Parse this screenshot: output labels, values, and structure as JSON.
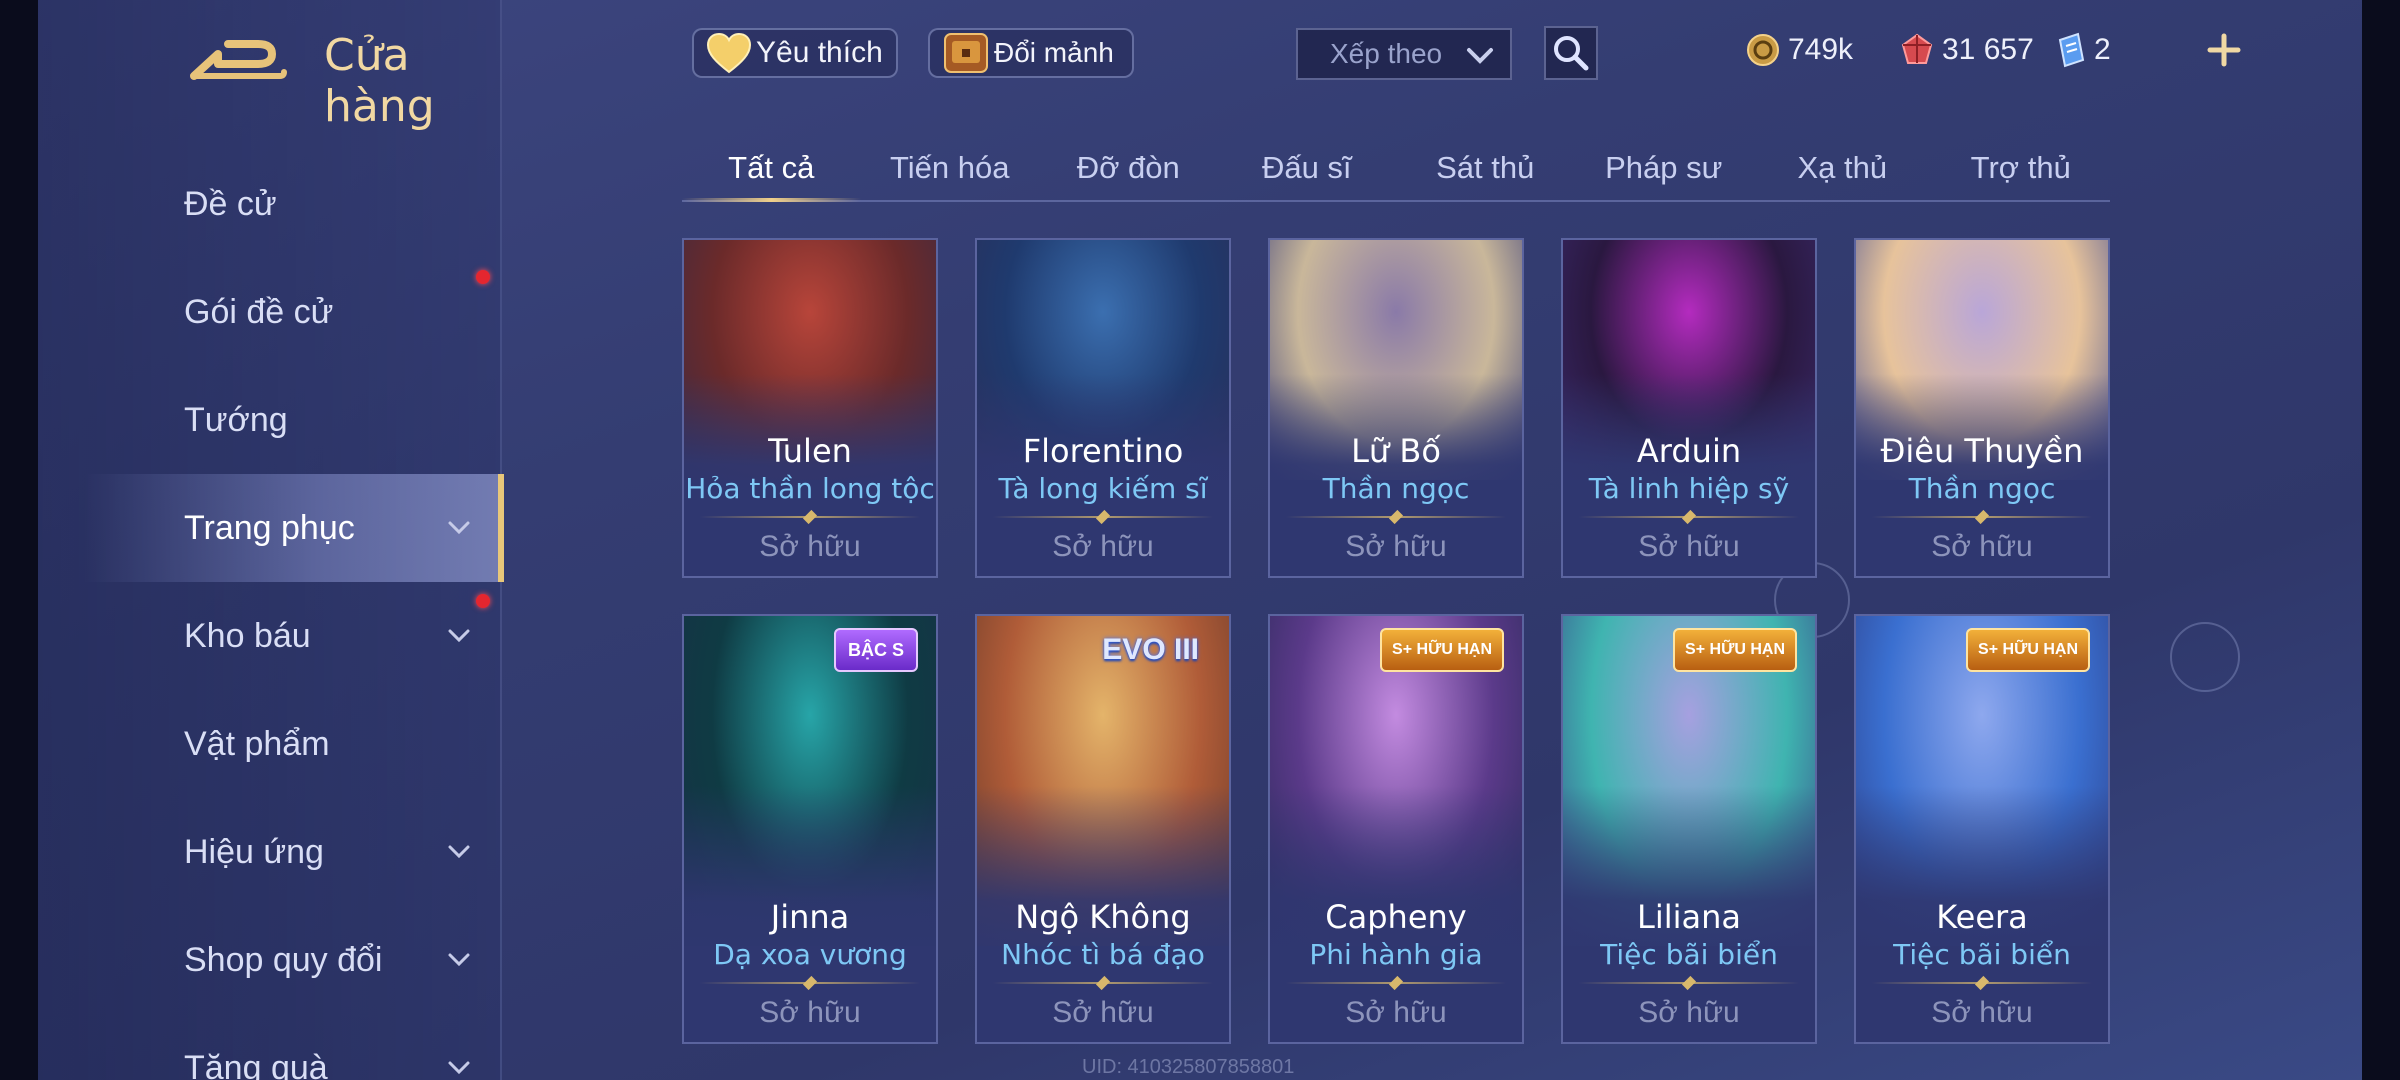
{
  "header": {
    "title": "Cửa hàng",
    "favorite_label": "Yêu thích",
    "fragment_label": "Đổi mảnh",
    "sort_placeholder": "Xếp theo"
  },
  "currencies": [
    {
      "icon": "gold-coin-icon",
      "value": "749k"
    },
    {
      "icon": "red-gem-icon",
      "value": "31 657"
    },
    {
      "icon": "blue-voucher-icon",
      "value": "2"
    }
  ],
  "sidebar": {
    "items": [
      {
        "label": "Đề cử",
        "has_chevron": false,
        "has_dot": false,
        "active": false
      },
      {
        "label": "Gói đề cử",
        "has_chevron": false,
        "has_dot": true,
        "active": false
      },
      {
        "label": "Tướng",
        "has_chevron": false,
        "has_dot": false,
        "active": false
      },
      {
        "label": "Trang phục",
        "has_chevron": true,
        "has_dot": false,
        "active": true
      },
      {
        "label": "Kho báu",
        "has_chevron": true,
        "has_dot": true,
        "active": false
      },
      {
        "label": "Vật phẩm",
        "has_chevron": false,
        "has_dot": false,
        "active": false
      },
      {
        "label": "Hiệu ứng",
        "has_chevron": true,
        "has_dot": false,
        "active": false
      },
      {
        "label": "Shop quy đổi",
        "has_chevron": true,
        "has_dot": false,
        "active": false
      },
      {
        "label": "Tặng quà",
        "has_chevron": true,
        "has_dot": false,
        "active": false
      }
    ]
  },
  "tabs": [
    {
      "label": "Tất cả",
      "active": true
    },
    {
      "label": "Tiến hóa",
      "active": false
    },
    {
      "label": "Đỡ đòn",
      "active": false
    },
    {
      "label": "Đấu sĩ",
      "active": false
    },
    {
      "label": "Sát thủ",
      "active": false
    },
    {
      "label": "Pháp sư",
      "active": false
    },
    {
      "label": "Xạ thủ",
      "active": false
    },
    {
      "label": "Trợ thủ",
      "active": false
    }
  ],
  "cards": [
    {
      "hero": "Tulen",
      "skin": "Hỏa thần long tộc",
      "status": "Sở hữu",
      "badge": "",
      "colors": [
        "#6b2a2a",
        "#b8453a",
        "#3b2a44"
      ]
    },
    {
      "hero": "Florentino",
      "skin": "Tà long kiếm sĩ",
      "status": "Sở hữu",
      "badge": "",
      "colors": [
        "#1f3a6e",
        "#3b6fb0",
        "#2a2f5a"
      ]
    },
    {
      "hero": "Lữ Bố",
      "skin": "Thần ngọc",
      "status": "Sở hữu",
      "badge": "",
      "colors": [
        "#c9b79a",
        "#8a7aa8",
        "#3a3f7a"
      ]
    },
    {
      "hero": "Arduin",
      "skin": "Tà linh hiệp sỹ",
      "status": "Sở hữu",
      "badge": "",
      "colors": [
        "#2a1840",
        "#b42bbf",
        "#3a2a6a"
      ]
    },
    {
      "hero": "Điêu Thuyền",
      "skin": "Thần ngọc",
      "status": "Sở hữu",
      "badge": "",
      "colors": [
        "#e7c39b",
        "#b9a6d8",
        "#454f92"
      ]
    },
    {
      "hero": "Jinna",
      "skin": "Dạ xoa vương",
      "status": "Sở hữu",
      "badge": "BẬC S",
      "badge_type": "bac",
      "colors": [
        "#0f3b44",
        "#27a5a8",
        "#173046"
      ]
    },
    {
      "hero": "Ngộ Không",
      "skin": "Nhóc tì bá đạo",
      "status": "Sở hữu",
      "badge": "EVO III",
      "badge_type": "evo",
      "colors": [
        "#b05c38",
        "#e4b46a",
        "#6b3b2a"
      ]
    },
    {
      "hero": "Capheny",
      "skin": "Phi hành gia",
      "status": "Sở hữu",
      "badge": "S+ HỮU HẠN",
      "badge_type": "splus",
      "colors": [
        "#5b3a8a",
        "#c38be0",
        "#2c2a5a"
      ]
    },
    {
      "hero": "Liliana",
      "skin": "Tiệc bãi biển",
      "status": "Sở hữu",
      "badge": "S+ HỮU HẠN",
      "badge_type": "splus",
      "colors": [
        "#3fb4b0",
        "#a6a0e0",
        "#3a4a8a"
      ]
    },
    {
      "hero": "Keera",
      "skin": "Tiệc bãi biển",
      "status": "Sở hữu",
      "badge": "S+ HỮU HẠN",
      "badge_type": "splus",
      "colors": [
        "#3a6fd0",
        "#8ea8ee",
        "#2e3f88"
      ]
    }
  ],
  "footer": {
    "uid": "UID: 410325807858801"
  }
}
